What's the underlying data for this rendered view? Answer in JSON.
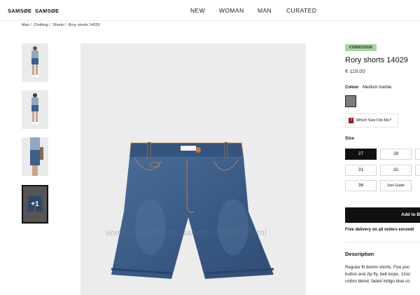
{
  "header": {
    "brand_primary": "SAMSØE",
    "brand_secondary": "SAMSØE",
    "nav": [
      "NEW",
      "WOMAN",
      "MAN",
      "CURATED"
    ]
  },
  "breadcrumb": [
    "Man /",
    "Clothing /",
    "Shorts /",
    "Rory shorts 14029"
  ],
  "gallery": {
    "more_label": "+1",
    "watermark": "www.kidstaff.com.ua/user-860875.html"
  },
  "product": {
    "badge": "CONSCIOUS",
    "title": "Rory shorts 14029",
    "price": "€ 119,00",
    "colour_label": "Colour",
    "colour_value": "Medium marble",
    "colour_hex": "#7b7e80",
    "size_fit_label": "Which Size Fits Me?",
    "size_label": "Size",
    "sizes": [
      "27",
      "28",
      "31",
      "32",
      "36",
      "Size Guide"
    ],
    "selected_size": "27",
    "add_to_bag": "Add to B",
    "delivery": "Free delivery on all orders exceedi",
    "description_title": "Description",
    "description_lines": [
      "Regular fit denim shorts. Five poc",
      "button and zip fly, belt loops. 13oz",
      "cotton blend, faded indigo blue co"
    ]
  },
  "colors": {
    "badge_bg": "#a8d3a3",
    "denim": "#3d5f8c",
    "button_dark": "#111111"
  }
}
